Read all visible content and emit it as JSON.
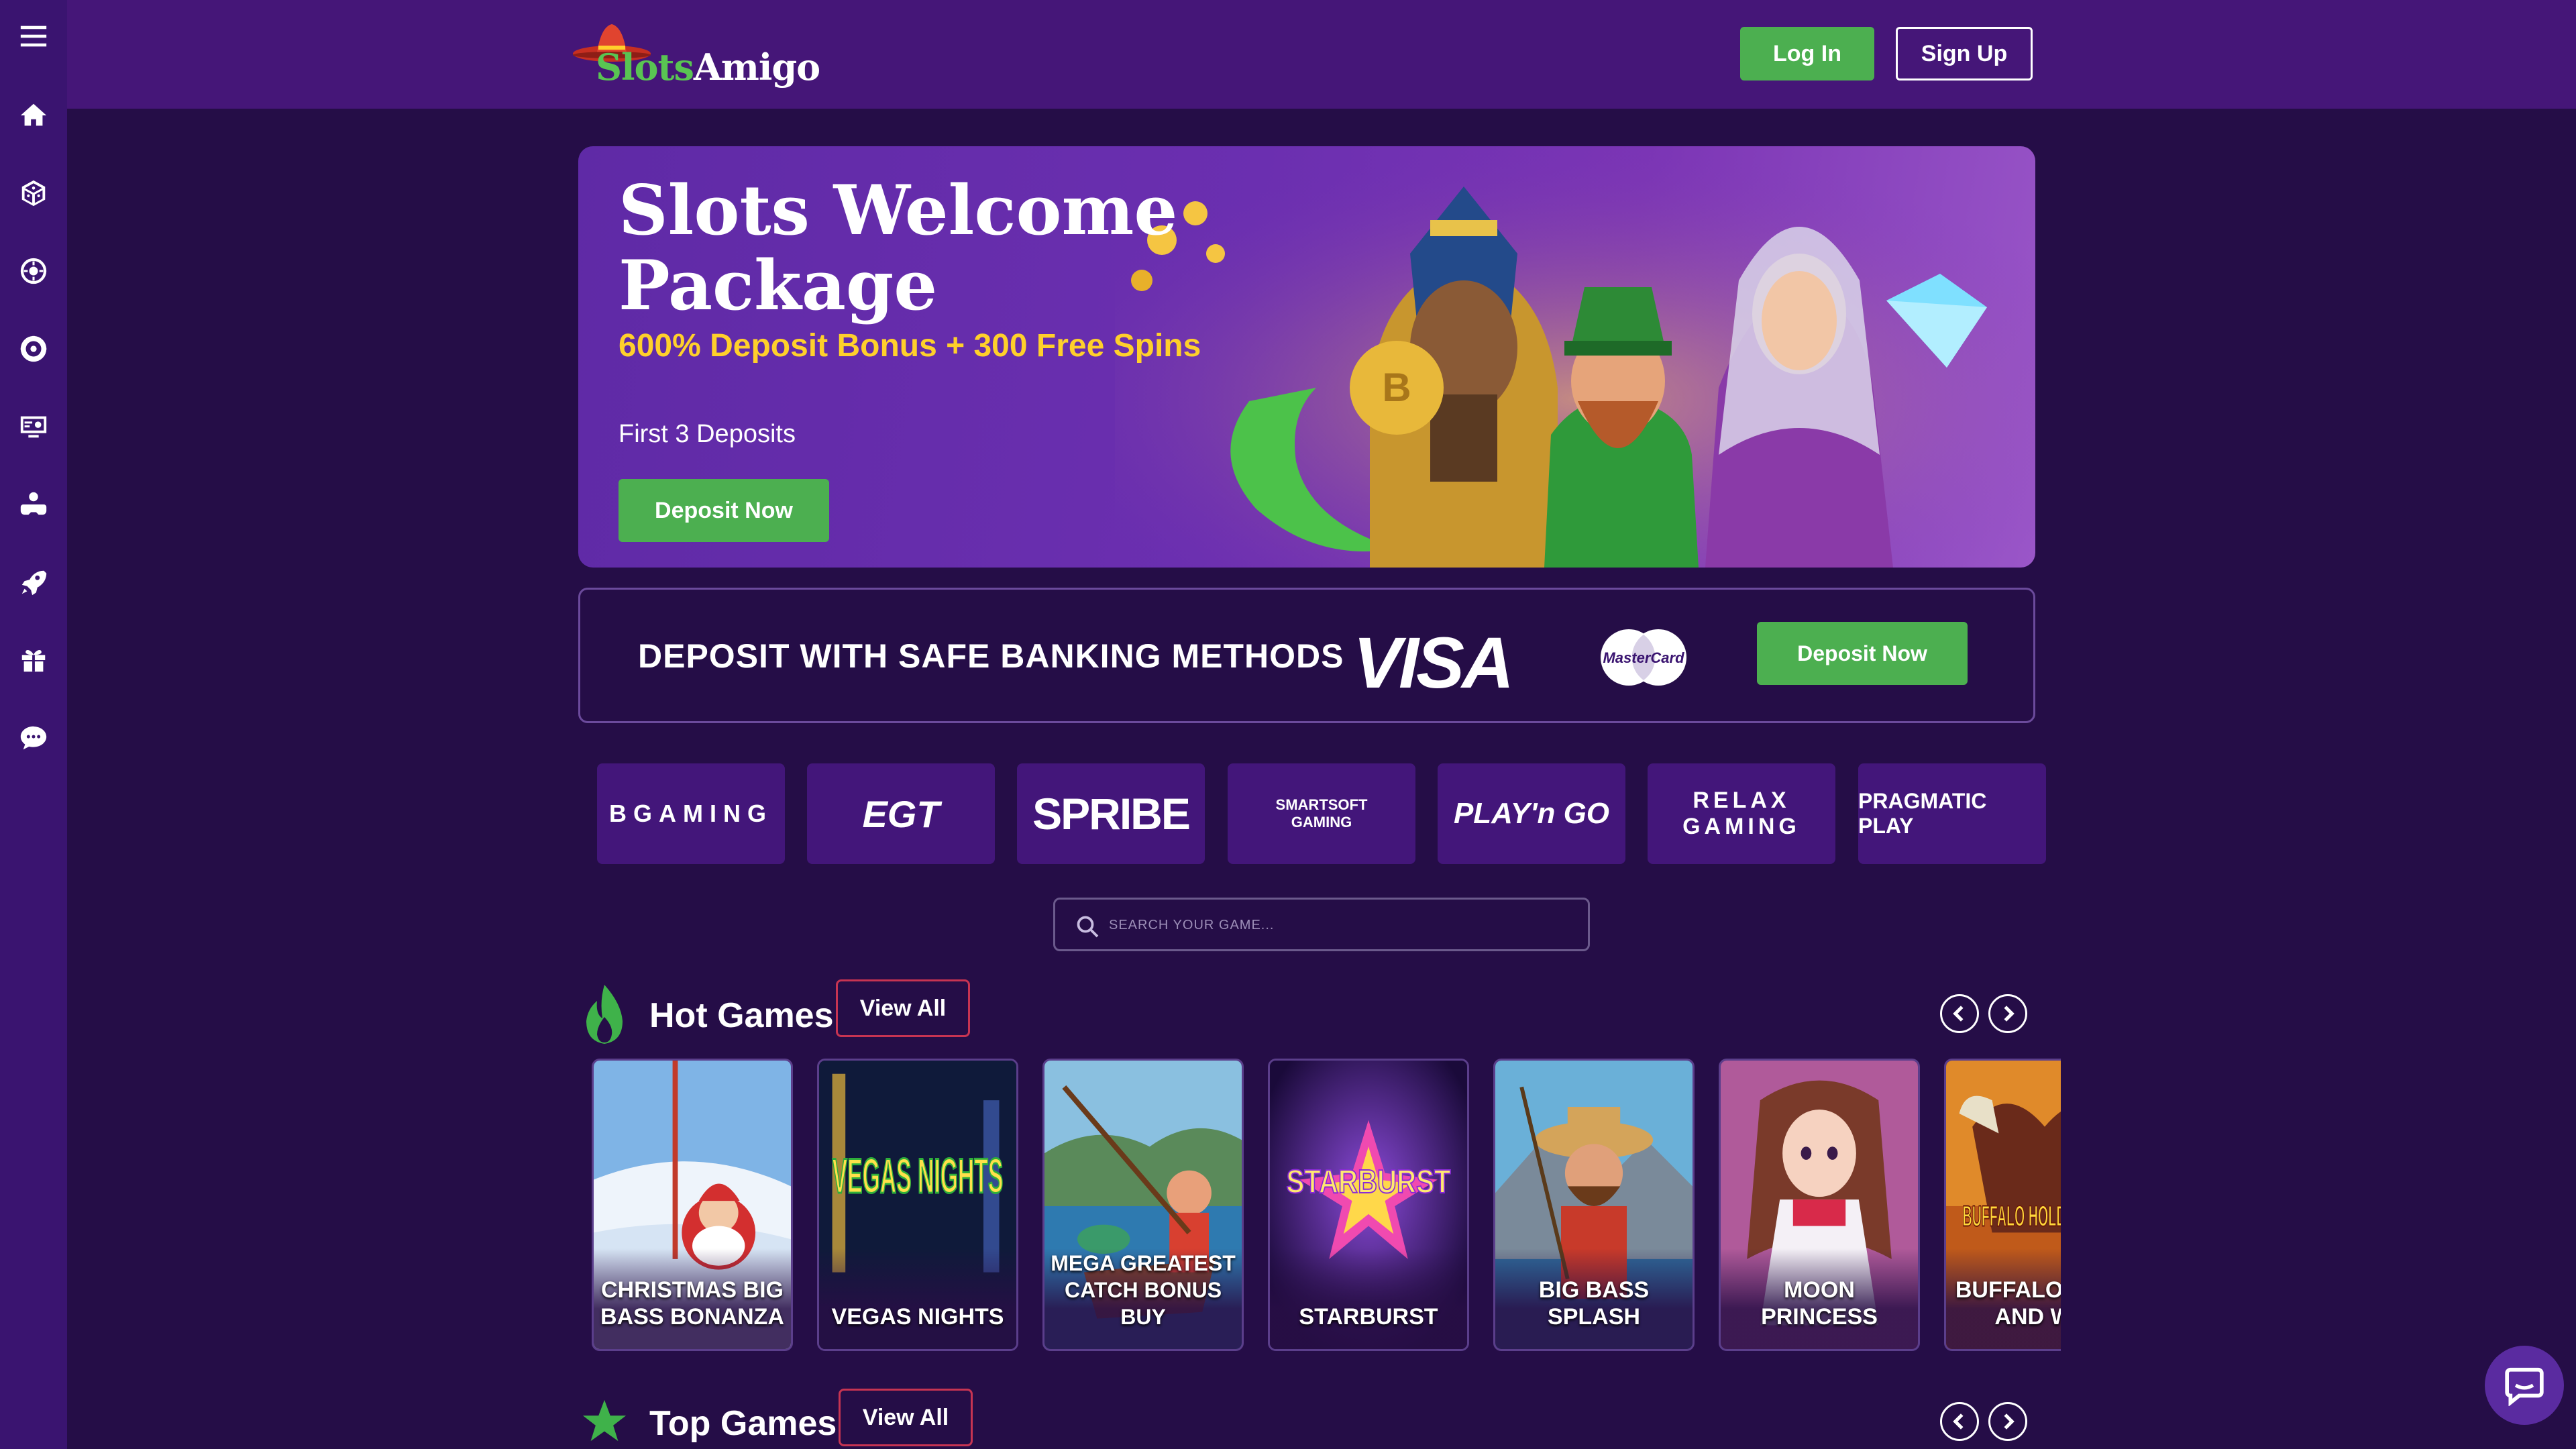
{
  "header": {
    "brand_green": "Slots",
    "brand_white": "Amigo",
    "login_label": "Log In",
    "signup_label": "Sign Up"
  },
  "sidebar": {
    "items": [
      {
        "icon": "menu-icon"
      },
      {
        "icon": "home-icon"
      },
      {
        "icon": "dice-icon"
      },
      {
        "icon": "roulette-icon"
      },
      {
        "icon": "poker-chip-icon"
      },
      {
        "icon": "live-casino-icon"
      },
      {
        "icon": "gamepad-icon"
      },
      {
        "icon": "rocket-icon"
      },
      {
        "icon": "gift-icon"
      },
      {
        "icon": "chat-bubble-icon"
      }
    ]
  },
  "hero": {
    "title": "Slots Welcome Package",
    "subtitle": "600% Deposit Bonus + 300 Free Spins",
    "deposits": "First 3 Deposits",
    "cta": "Deposit Now"
  },
  "banking": {
    "text": "DEPOSIT WITH SAFE BANKING METHODS",
    "visa": "VISA",
    "mastercard": "MasterCard",
    "cta": "Deposit Now"
  },
  "providers": [
    "BGAMING",
    "EGT",
    "SPRIBE",
    "SMARTSOFT GAMING",
    "PLAY'n GO",
    "RELAX GAMING",
    "PRAGMATIC PLAY"
  ],
  "search": {
    "placeholder": "SEARCH YOUR GAME..."
  },
  "hot_games": {
    "title": "Hot Games",
    "view_all": "View All",
    "games": [
      {
        "name": "CHRISTMAS BIG BASS BONANZA",
        "art_text": ""
      },
      {
        "name": "VEGAS NIGHTS",
        "art_text": "VEGAS NIGHTS"
      },
      {
        "name": "MEGA GREATEST CATCH BONUS BUY",
        "art_text": ""
      },
      {
        "name": "STARBURST",
        "art_text": "STARBURST"
      },
      {
        "name": "BIG BASS SPLASH",
        "art_text": ""
      },
      {
        "name": "MOON PRINCESS",
        "art_text": ""
      },
      {
        "name": "BUFFALO HOLD AND WIN",
        "art_text": "BUFFALO HOLD AND WIN"
      }
    ]
  },
  "top_games": {
    "title": "Top Games",
    "view_all": "View All"
  },
  "colors": {
    "background": "#250d47",
    "sidebar": "#3a1470",
    "topbar": "#451678",
    "accent_green": "#4caf50",
    "accent_yellow": "#ffd02b",
    "view_all_border": "#c73452"
  }
}
